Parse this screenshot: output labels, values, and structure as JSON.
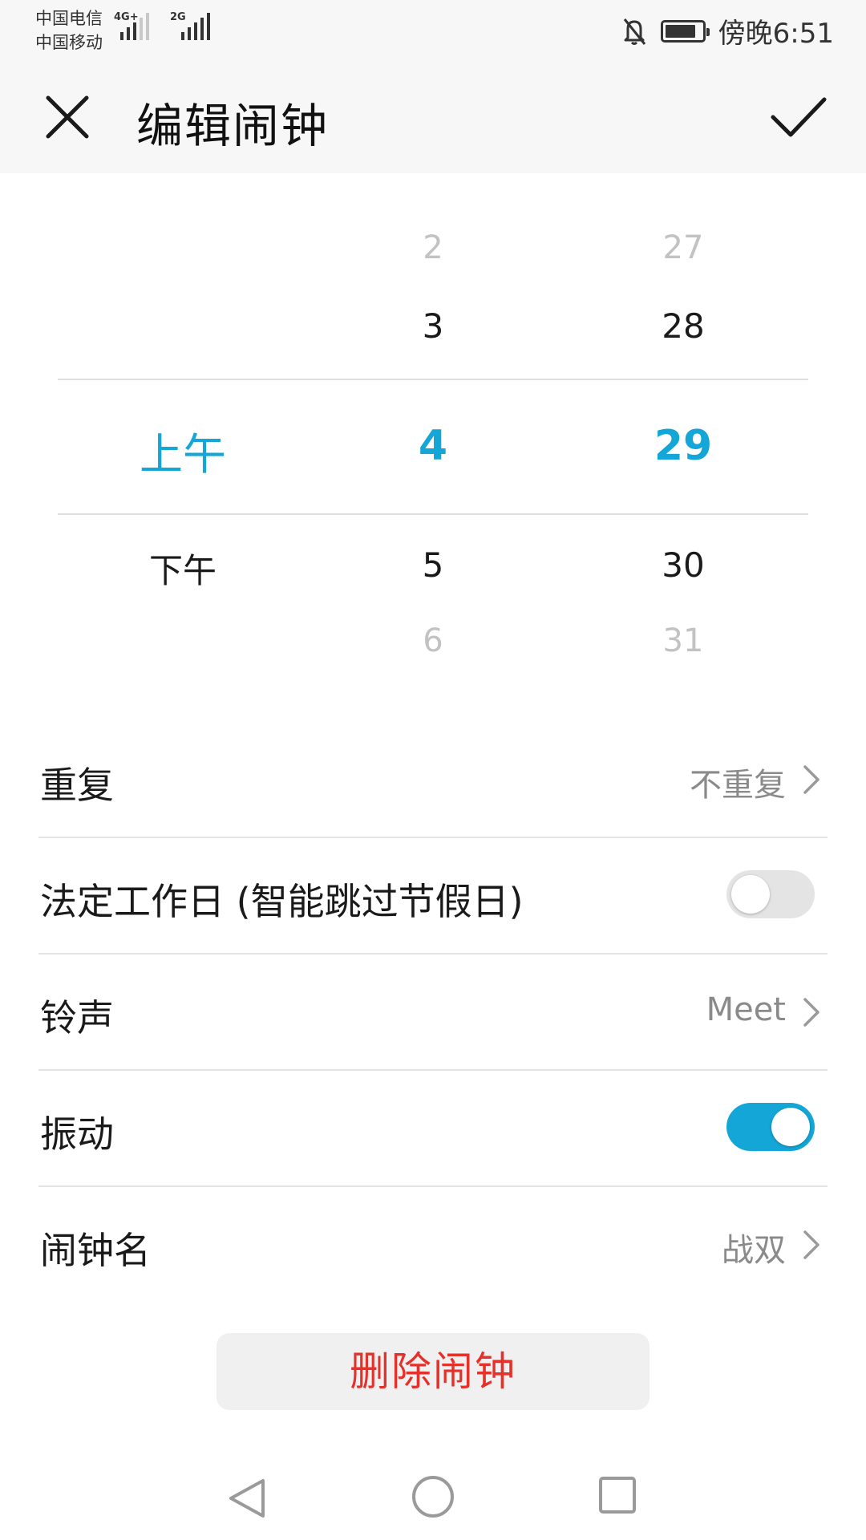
{
  "status_bar": {
    "carrier1": "中国电信",
    "carrier2": "中国移动",
    "network1": "4G+",
    "network2": "2G",
    "time": "傍晚6:51",
    "icons": [
      "signal-icon",
      "notifications-off-icon",
      "battery-icon"
    ]
  },
  "header": {
    "title": "编辑闹钟",
    "close_icon": "close-icon",
    "confirm_icon": "check-icon"
  },
  "picker": {
    "ampm": {
      "selected": "上午",
      "below": "下午"
    },
    "hour": {
      "above_far": "2",
      "above": "3",
      "selected": "4",
      "below": "5",
      "below_far": "6"
    },
    "minute": {
      "above_far": "27",
      "above": "28",
      "selected": "29",
      "below": "30",
      "below_far": "31"
    }
  },
  "settings": {
    "repeat": {
      "label": "重复",
      "value": "不重复"
    },
    "workday": {
      "label": "法定工作日 (智能跳过节假日)",
      "enabled": false
    },
    "ringtone": {
      "label": "铃声",
      "value": "Meet"
    },
    "vibrate": {
      "label": "振动",
      "enabled": true
    },
    "alarm_name": {
      "label": "闹钟名",
      "value": "战双"
    }
  },
  "delete_label": "删除闹钟",
  "nav": {
    "icons": [
      "back-icon",
      "home-icon",
      "recents-icon"
    ]
  },
  "colors": {
    "accent": "#13a6d6",
    "danger": "#e5312a",
    "bar_background": "#f7f7f7",
    "muted_text": "#8a8a8a"
  }
}
